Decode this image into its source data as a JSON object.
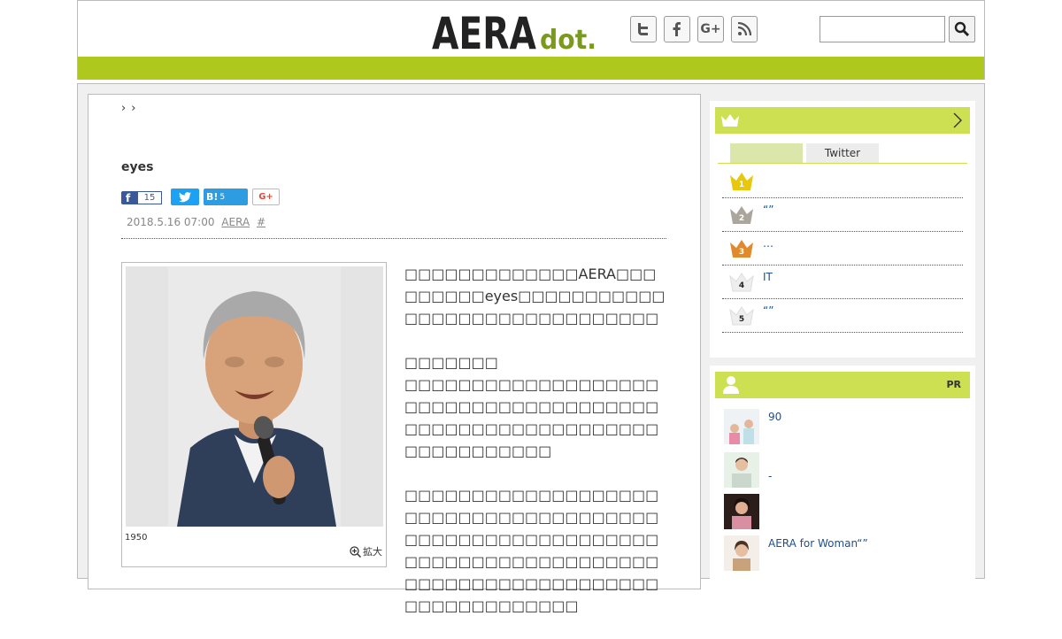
{
  "brand": {
    "logo_main": "AERA",
    "logo_dot": "dot.",
    "accent": "#aec81e",
    "sidebar_accent": "#cde052"
  },
  "social": [
    {
      "name": "twitter-icon"
    },
    {
      "name": "facebook-icon"
    },
    {
      "name": "google-plus-icon",
      "glyph": "G+"
    },
    {
      "name": "rss-icon"
    }
  ],
  "search": {
    "placeholder": ""
  },
  "breadcrumb": [
    "›",
    "›"
  ],
  "article": {
    "title": "eyes",
    "share": {
      "facebook_count": "15",
      "hatena_label": "B!",
      "hatena_count": "5",
      "gplus_label": "G+"
    },
    "date": "2018.5.16 07:00",
    "source": "AERA",
    "tag": "#",
    "photo_caption": "1950",
    "zoom_label": "拡大",
    "paragraphs": [
      "□□□□□□□□□□□□□AERA□□□□□□□□□eyes□□□□□□□□□□□□□□□□□□□□□□□□□□□□□□",
      "□□□□□□□",
      "□□□□□□□□□□□□□□□□□□□□□□□□□□□□□□□□□□□□□□□□□□□□□□□□□□□□□□□□□□□□□□□□□□□□",
      "□□□□□□□□□□□□□□□□□□□□□□□□□□□□□□□□□□□□□□□□□□□□□□□□□□□□□□□□□□□□□□□□□□□□□□□□□□□□□□□□□□□□□□□□□□□□□□□□□□□□□□□□□□□□"
    ]
  },
  "ranking": {
    "tabs": [
      "",
      "Twitter"
    ],
    "items": [
      {
        "rank": "1",
        "title": "",
        "color": "#e8c80c"
      },
      {
        "rank": "2",
        "title": "“”",
        "color": "#aaa69c"
      },
      {
        "rank": "3",
        "title": "…",
        "color": "#e08a2c"
      },
      {
        "rank": "4",
        "title": "IT",
        "color": "#f2f2f2"
      },
      {
        "rank": "5",
        "title": "“”",
        "color": "#f2f2f2"
      }
    ]
  },
  "pr": {
    "label": "PR",
    "items": [
      {
        "title": "90"
      },
      {
        "title": "-"
      },
      {
        "title": ""
      },
      {
        "title": "AERA for Woman“”"
      }
    ]
  }
}
